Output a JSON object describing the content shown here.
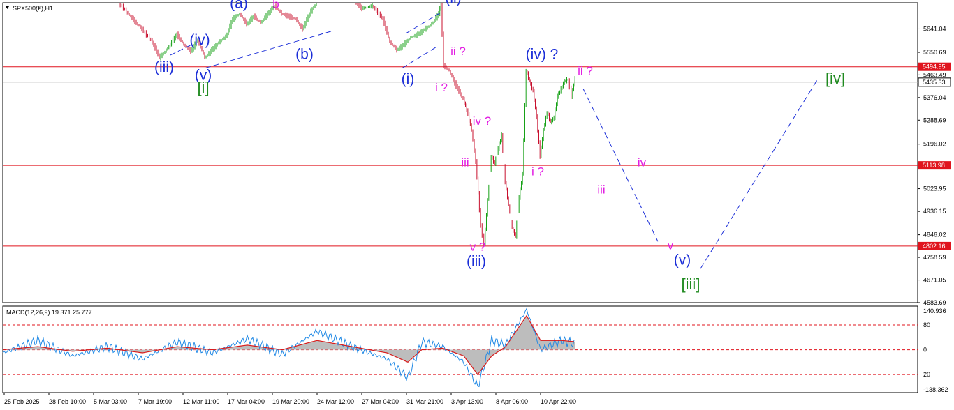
{
  "header": {
    "symbol": "SPX500(€),H1"
  },
  "colors": {
    "bull": "#17a117",
    "bear": "#c8102e",
    "level": "#e0141e",
    "grid": "#c8c8c8",
    "wave_blue": "#1c2fd8",
    "wave_magenta": "#e21ce2",
    "wave_green": "#1f8a1f",
    "projection": "#1c2fd8",
    "macd_line": "#1e88e5",
    "signal_line": "#d81b1b",
    "histogram": "#bdbdbd"
  },
  "chart_data": [
    {
      "type": "candlestick",
      "title": "SPX500(€),H1",
      "ylim": [
        4583.69,
        5742.0
      ],
      "y_ticks": [
        "5641.04",
        "5550.69",
        "5463.49",
        "5376.04",
        "5288.69",
        "5196.02",
        "5023.95",
        "4936.15",
        "4846.02",
        "4758.59",
        "4671.05",
        "4583.69"
      ],
      "x_ticks": [
        "25 Feb 2025",
        "28 Feb 10:00",
        "5 Mar 03:00",
        "7 Mar 19:00",
        "12 Mar 11:00",
        "17 Mar 04:00",
        "19 Mar 20:00",
        "24 Mar 12:00",
        "27 Mar 04:00",
        "31 Mar 21:00",
        "3 Apr 13:00",
        "8 Apr 06:00",
        "10 Apr 22:00"
      ],
      "current_price": {
        "label": "5435.33",
        "value": 5435.33
      },
      "levels": [
        {
          "label": "5494.95",
          "value": 5494.95
        },
        {
          "label": "5113.98",
          "value": 5113.98
        },
        {
          "label": "4802.16",
          "value": 4802.16
        }
      ],
      "price_path": [
        [
          0.167,
          5742
        ],
        [
          0.18,
          5700
        ],
        [
          0.2,
          5640
        ],
        [
          0.215,
          5590
        ],
        [
          0.225,
          5530
        ],
        [
          0.235,
          5560
        ],
        [
          0.25,
          5620
        ],
        [
          0.26,
          5580
        ],
        [
          0.27,
          5555
        ],
        [
          0.28,
          5600
        ],
        [
          0.29,
          5530
        ],
        [
          0.3,
          5560
        ],
        [
          0.31,
          5590
        ],
        [
          0.32,
          5610
        ],
        [
          0.33,
          5680
        ],
        [
          0.34,
          5700
        ],
        [
          0.35,
          5660
        ],
        [
          0.36,
          5690
        ],
        [
          0.37,
          5665
        ],
        [
          0.38,
          5700
        ],
        [
          0.39,
          5730
        ],
        [
          0.4,
          5700
        ],
        [
          0.41,
          5690
        ],
        [
          0.42,
          5680
        ],
        [
          0.43,
          5640
        ],
        [
          0.44,
          5700
        ],
        [
          0.45,
          5742
        ],
        [
          0.505,
          5742
        ],
        [
          0.515,
          5720
        ],
        [
          0.53,
          5730
        ],
        [
          0.545,
          5680
        ],
        [
          0.555,
          5590
        ],
        [
          0.565,
          5560
        ],
        [
          0.575,
          5580
        ],
        [
          0.585,
          5610
        ],
        [
          0.595,
          5620
        ],
        [
          0.605,
          5640
        ],
        [
          0.615,
          5660
        ],
        [
          0.625,
          5700
        ],
        [
          0.628,
          5742
        ],
        [
          0.632,
          5500
        ],
        [
          0.64,
          5480
        ],
        [
          0.65,
          5420
        ],
        [
          0.66,
          5370
        ],
        [
          0.665,
          5330
        ],
        [
          0.672,
          5250
        ],
        [
          0.678,
          5130
        ],
        [
          0.685,
          4880
        ],
        [
          0.69,
          4810
        ],
        [
          0.695,
          4980
        ],
        [
          0.7,
          5150
        ],
        [
          0.705,
          5120
        ],
        [
          0.71,
          5180
        ],
        [
          0.715,
          5230
        ],
        [
          0.72,
          5050
        ],
        [
          0.725,
          4960
        ],
        [
          0.73,
          4870
        ],
        [
          0.735,
          4840
        ],
        [
          0.74,
          4990
        ],
        [
          0.745,
          5080
        ],
        [
          0.75,
          5480
        ],
        [
          0.755,
          5440
        ],
        [
          0.76,
          5400
        ],
        [
          0.765,
          5300
        ],
        [
          0.77,
          5150
        ],
        [
          0.775,
          5250
        ],
        [
          0.78,
          5320
        ],
        [
          0.785,
          5280
        ],
        [
          0.79,
          5300
        ],
        [
          0.795,
          5380
        ],
        [
          0.8,
          5410
        ],
        [
          0.805,
          5440
        ],
        [
          0.81,
          5445
        ],
        [
          0.815,
          5380
        ],
        [
          0.82,
          5450
        ]
      ],
      "projection_path": [
        [
          0.831,
          5410
        ],
        [
          0.938,
          4820
        ],
        [
          0.999,
          4715
        ],
        [
          1.168,
          5452
        ]
      ],
      "labels": [
        {
          "text": "(a)",
          "at": [
            0.338,
            5722
          ],
          "color": "blue"
        },
        {
          "text": "b",
          "at": [
            0.391,
            5722
          ],
          "color": "magenta"
        },
        {
          "text": "(iv)",
          "at": [
            0.282,
            5580
          ],
          "color": "blue"
        },
        {
          "text": "(iii)",
          "at": [
            0.231,
            5475
          ],
          "color": "blue"
        },
        {
          "text": "(v)",
          "at": [
            0.287,
            5445
          ],
          "color": "blue"
        },
        {
          "text": "[i]",
          "at": [
            0.287,
            5395
          ],
          "color": "green"
        },
        {
          "text": "(b)",
          "at": [
            0.432,
            5525
          ],
          "color": "blue"
        },
        {
          "text": "(ii)",
          "at": [
            0.645,
            5742
          ],
          "color": "blue"
        },
        {
          "text": "(i)",
          "at": [
            0.58,
            5430
          ],
          "color": "blue"
        },
        {
          "text": "ii ?",
          "at": [
            0.652,
            5540
          ],
          "color": "magenta"
        },
        {
          "text": "i ?",
          "at": [
            0.628,
            5400
          ],
          "color": "magenta"
        },
        {
          "text": "(iv) ?",
          "at": [
            0.772,
            5525
          ],
          "color": "blue"
        },
        {
          "text": "ii ?",
          "at": [
            0.834,
            5465
          ],
          "color": "magenta"
        },
        {
          "text": "iv ?",
          "at": [
            0.686,
            5270
          ],
          "color": "magenta"
        },
        {
          "text": "iii",
          "at": [
            0.662,
            5110
          ],
          "color": "magenta"
        },
        {
          "text": "i ?",
          "at": [
            0.766,
            5075
          ],
          "color": "magenta"
        },
        {
          "text": "v ?",
          "at": [
            0.68,
            4785
          ],
          "color": "magenta"
        },
        {
          "text": "(iii)",
          "at": [
            0.678,
            4725
          ],
          "color": "blue"
        },
        {
          "text": "iv",
          "at": [
            0.915,
            5110
          ],
          "color": "magenta"
        },
        {
          "text": "iii",
          "at": [
            0.857,
            5005
          ],
          "color": "magenta"
        },
        {
          "text": "v",
          "at": [
            0.956,
            4790
          ],
          "color": "magenta"
        },
        {
          "text": "(v)",
          "at": [
            0.973,
            4730
          ],
          "color": "blue"
        },
        {
          "text": "[iii]",
          "at": [
            0.985,
            4635
          ],
          "color": "green"
        },
        {
          "text": "[iv]",
          "at": [
            1.192,
            5430
          ],
          "color": "green"
        }
      ],
      "wave_boxes": [
        {
          "lines": [
            [
              [
                0.24,
                5540
              ],
              [
                0.27,
                5580
              ]
            ],
            [
              [
                0.29,
                5490
              ],
              [
                0.47,
                5632
              ]
            ]
          ]
        },
        {
          "lines": [
            [
              [
                0.578,
                5625
              ],
              [
                0.628,
                5706
              ]
            ],
            [
              [
                0.572,
                5490
              ],
              [
                0.62,
                5570
              ]
            ]
          ]
        }
      ]
    },
    {
      "type": "line",
      "title": "MACD(12,26,9) 19.371 25.777",
      "indicator": "MACD",
      "params": "(12,26,9)",
      "macd_value": "19.371",
      "signal_value": "25.777",
      "ylim": [
        -138.362,
        140.936
      ],
      "y_ticks": [
        "140.936",
        "80",
        "0",
        "20",
        "-138.362"
      ],
      "dashed_levels": [
        80,
        0,
        -80
      ],
      "macd": [
        [
          0.0,
          -10
        ],
        [
          0.05,
          30
        ],
        [
          0.1,
          -20
        ],
        [
          0.15,
          10
        ],
        [
          0.2,
          -30
        ],
        [
          0.25,
          25
        ],
        [
          0.3,
          -10
        ],
        [
          0.35,
          35
        ],
        [
          0.4,
          -15
        ],
        [
          0.45,
          60
        ],
        [
          0.5,
          10
        ],
        [
          0.55,
          -30
        ],
        [
          0.58,
          -90
        ],
        [
          0.6,
          25
        ],
        [
          0.63,
          10
        ],
        [
          0.66,
          -40
        ],
        [
          0.68,
          -120
        ],
        [
          0.7,
          30
        ],
        [
          0.72,
          15
        ],
        [
          0.75,
          130
        ],
        [
          0.77,
          0
        ],
        [
          0.8,
          30
        ],
        [
          0.82,
          19.371
        ]
      ],
      "signal": [
        [
          0.0,
          0
        ],
        [
          0.05,
          10
        ],
        [
          0.1,
          -5
        ],
        [
          0.15,
          5
        ],
        [
          0.2,
          -10
        ],
        [
          0.25,
          10
        ],
        [
          0.3,
          0
        ],
        [
          0.35,
          15
        ],
        [
          0.4,
          0
        ],
        [
          0.45,
          30
        ],
        [
          0.5,
          10
        ],
        [
          0.55,
          -10
        ],
        [
          0.58,
          -40
        ],
        [
          0.6,
          0
        ],
        [
          0.63,
          5
        ],
        [
          0.66,
          -20
        ],
        [
          0.68,
          -80
        ],
        [
          0.7,
          -20
        ],
        [
          0.72,
          10
        ],
        [
          0.75,
          110
        ],
        [
          0.77,
          30
        ],
        [
          0.8,
          30
        ],
        [
          0.82,
          25.777
        ]
      ]
    }
  ]
}
